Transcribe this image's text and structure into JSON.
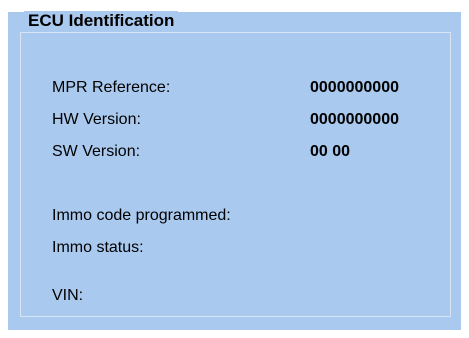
{
  "section": {
    "title": "ECU Identification"
  },
  "fields": [
    {
      "label": "MPR Reference:",
      "value": "0000000000"
    },
    {
      "label": "HW Version:",
      "value": "0000000000"
    },
    {
      "label": "SW Version:",
      "value": "00 00"
    },
    {
      "label": "Immo code programmed:",
      "value": ""
    },
    {
      "label": "Immo status:",
      "value": ""
    },
    {
      "label": "VIN:",
      "value": ""
    }
  ],
  "colors": {
    "panel_background": "#a9c9ee",
    "groupbox_border": "#d6e4f5"
  }
}
